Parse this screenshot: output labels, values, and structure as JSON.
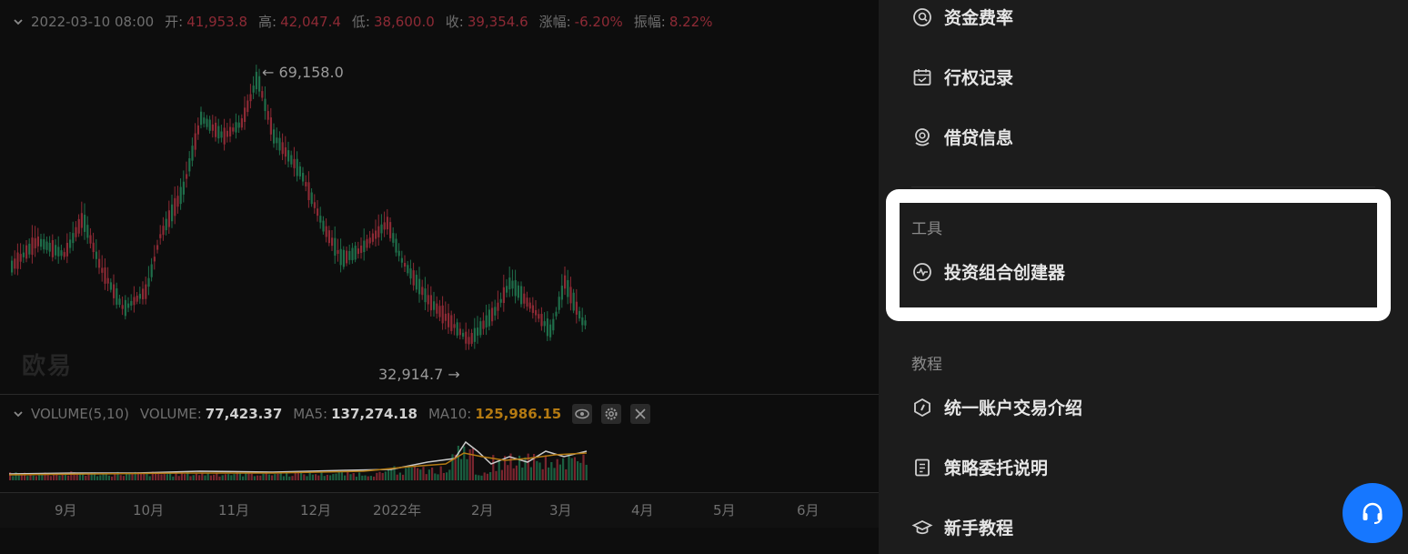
{
  "header": {
    "datetime": "2022-03-10 08:00",
    "open_label": "开:",
    "open": "41,953.8",
    "high_label": "高:",
    "high": "42,047.4",
    "low_label": "低:",
    "low": "38,600.0",
    "close_label": "收:",
    "close": "39,354.6",
    "change_label": "涨幅:",
    "change": "-6.20%",
    "amplitude_label": "振幅:",
    "amplitude": "8.22%"
  },
  "price_chart": {
    "high_marker": "← 69,158.0",
    "low_marker": "32,914.7 →",
    "watermark": "欧易",
    "colors": {
      "up": "#1f6e4a",
      "down": "#8d2a35"
    }
  },
  "volume_panel": {
    "title": "VOLUME(5,10)",
    "volume_label": "VOLUME:",
    "volume": "77,423.37",
    "ma5_label": "MA5:",
    "ma5": "137,274.18",
    "ma10_label": "MA10:",
    "ma10": "125,986.15"
  },
  "x_axis": [
    "9月",
    "10月",
    "11月",
    "12月",
    "2022年",
    "2月",
    "3月",
    "4月",
    "5月",
    "6月"
  ],
  "sidebar": {
    "items_top": [
      {
        "label": "资金费率",
        "icon": "funding-rate-icon"
      },
      {
        "label": "行权记录",
        "icon": "calendar-icon"
      },
      {
        "label": "借贷信息",
        "icon": "loan-icon"
      }
    ],
    "tools_section": "工具",
    "tools_item": {
      "label": "投资组合创建器",
      "icon": "portfolio-pulse-icon"
    },
    "tutorial_section": "教程",
    "tutorial_items": [
      {
        "label": "统一账户交易介绍",
        "icon": "compass-icon"
      },
      {
        "label": "策略委托说明",
        "icon": "document-icon"
      },
      {
        "label": "新手教程",
        "icon": "graduation-cap-icon"
      }
    ]
  },
  "chart_data": {
    "type": "candlestick",
    "title": "",
    "x_axis_labels": [
      "9月",
      "10月",
      "11月",
      "12月",
      "2022年",
      "2月",
      "3月",
      "4月",
      "5月",
      "6月"
    ],
    "highlight_high": 69158.0,
    "highlight_low": 32914.7,
    "volume": {
      "current": 77423.37,
      "ma5": 137274.18,
      "ma10": 125986.15
    }
  }
}
